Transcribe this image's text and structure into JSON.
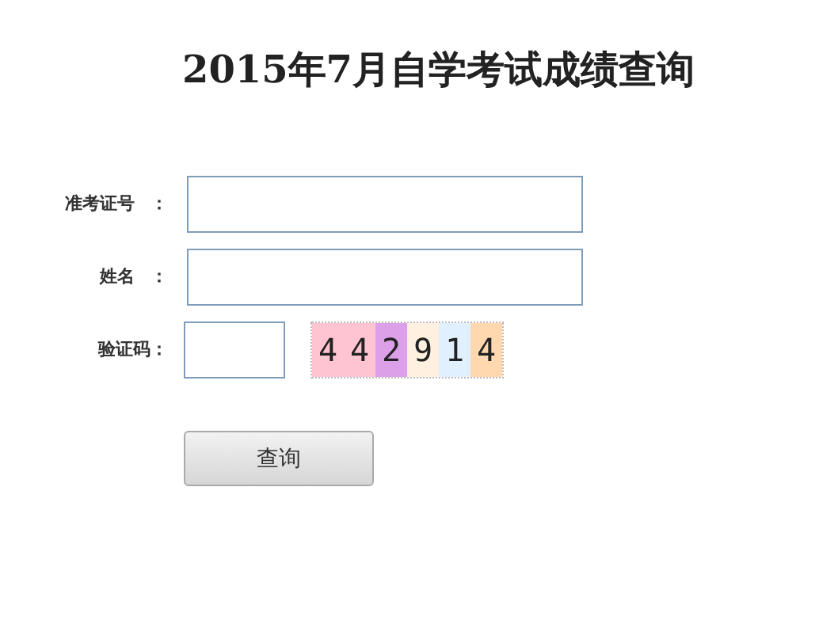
{
  "title": "2015年7月自学考试成绩查询",
  "fields": [
    {
      "label": "准考证号",
      "colon": "：",
      "kind": "wide"
    },
    {
      "label": "姓名",
      "colon": "：",
      "kind": "wide"
    },
    {
      "label": "验证码：",
      "kind": "captcha"
    }
  ],
  "captcha": [
    {
      "text": "4",
      "color": "#ffc4d2"
    },
    {
      "text": "4",
      "color": "#ffc4d2"
    },
    {
      "text": "2",
      "color": "#dca0e8"
    },
    {
      "text": "9",
      "color": "#fff0e0"
    },
    {
      "text": "1",
      "color": "#e0f0ff"
    },
    {
      "text": "4",
      "color": "#ffd8b0"
    }
  ],
  "button": "查询"
}
